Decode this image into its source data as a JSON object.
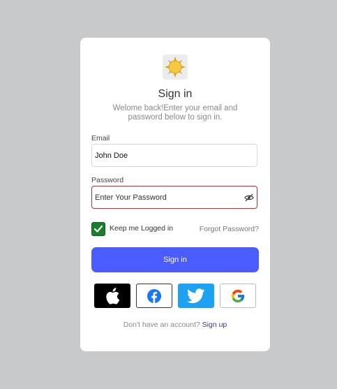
{
  "header": {
    "title": "Sign in",
    "subtitle": "Welome back!Enter your email and password below to sign in."
  },
  "form": {
    "email_label": "Email",
    "email_value": "John Doe",
    "password_label": "Password",
    "password_placeholder": "Enter Your Password",
    "keep_logged_in_label": "Keep me Logged in",
    "keep_logged_in_checked": true,
    "forgot_password": "Forgot Password?",
    "signin_button": "Sign in"
  },
  "social_logins": [
    {
      "provider": "Apple",
      "icon": "apple-icon"
    },
    {
      "provider": "Facebook",
      "icon": "facebook-icon"
    },
    {
      "provider": "Twitter",
      "icon": "twitter-icon"
    },
    {
      "provider": "Google",
      "icon": "google-icon"
    }
  ],
  "footer": {
    "prompt": "Don't have an account?",
    "signup_link": "Sign up"
  },
  "colors": {
    "primary": "#4b5cff",
    "error_border": "#c0272d",
    "checkbox": "#1a7f2b",
    "twitter": "#1da1f2"
  }
}
